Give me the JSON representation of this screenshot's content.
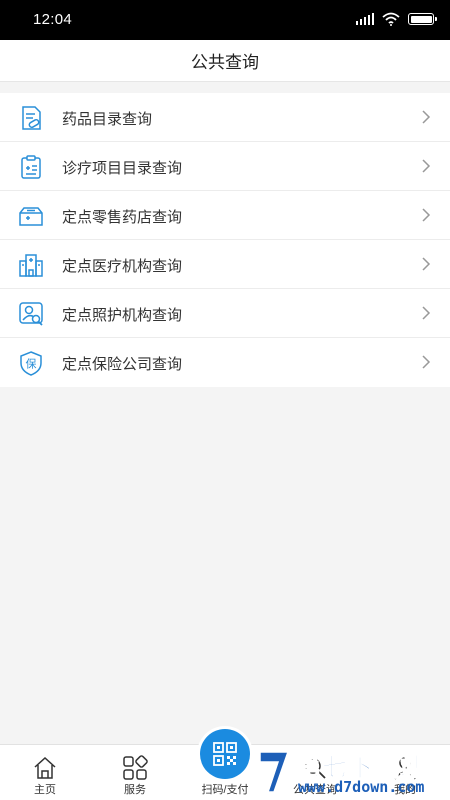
{
  "status_bar": {
    "time": "12:04"
  },
  "header": {
    "title": "公共查询"
  },
  "menu": {
    "items": [
      {
        "label": "药品目录查询",
        "icon": "drug-catalog-icon"
      },
      {
        "label": "诊疗项目目录查询",
        "icon": "clipboard-medical-icon"
      },
      {
        "label": "定点零售药店查询",
        "icon": "medicine-box-icon"
      },
      {
        "label": "定点医疗机构查询",
        "icon": "hospital-building-icon"
      },
      {
        "label": "定点照护机构查询",
        "icon": "person-search-icon"
      },
      {
        "label": "定点保险公司查询",
        "icon": "insurance-shield-icon"
      }
    ]
  },
  "tab_bar": {
    "tabs": [
      {
        "label": "主页",
        "icon": "home-icon"
      },
      {
        "label": "服务",
        "icon": "grid-icon"
      },
      {
        "label": "扫码/支付",
        "icon": "qr-code-icon"
      },
      {
        "label": "公共查询",
        "icon": "search-icon"
      },
      {
        "label": "我的",
        "icon": "user-icon"
      }
    ]
  },
  "watermark": {
    "brand": "第七下载站",
    "url": "www.d7down.com"
  },
  "colors": {
    "accent": "#1b8be0",
    "icon_blue": "#2a8fd8",
    "watermark": "#1d5fb8"
  }
}
